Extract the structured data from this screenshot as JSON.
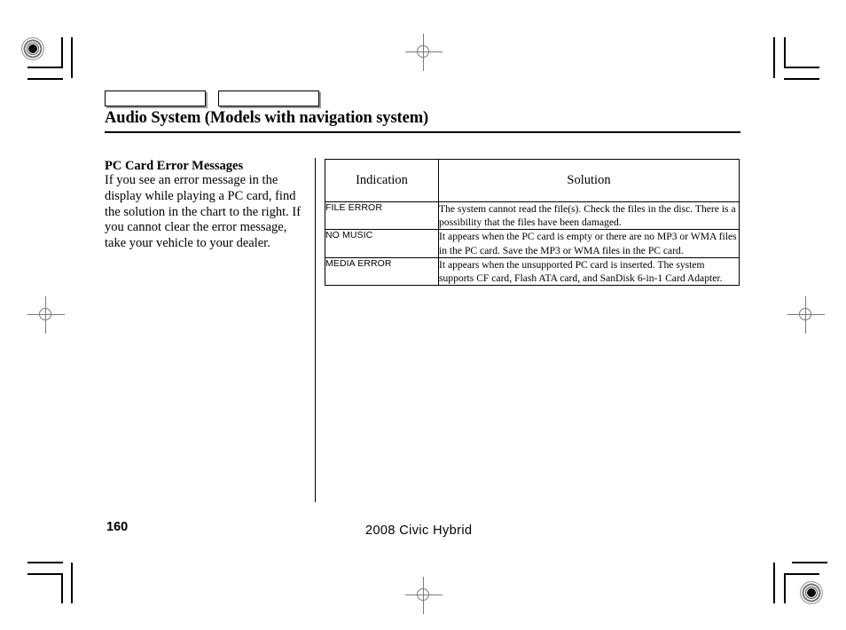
{
  "document": {
    "title": "Audio System (Models with navigation system)",
    "page_number": "160",
    "footer_model": "2008  Civic  Hybrid"
  },
  "header": {
    "tab_box_1_label": "",
    "tab_box_2_label": ""
  },
  "left_column": {
    "heading": "PC Card Error Messages",
    "body": "If you see an error message in the display while playing a PC card, find the solution in the chart to the right. If you cannot clear the error message, take your vehicle to your dealer."
  },
  "table": {
    "columns": [
      "Indication",
      "Solution"
    ],
    "rows": [
      {
        "indication": "FILE ERROR",
        "solution": "The system cannot read the file(s). Check the files in the disc. There is a possibility that the files have been damaged."
      },
      {
        "indication": "NO MUSIC",
        "solution": "It appears when the PC card is empty or there are no MP3 or WMA files in the PC card. Save the MP3 or WMA files in the PC card."
      },
      {
        "indication": "MEDIA ERROR",
        "solution": "It appears when the unsupported PC card is inserted. The system supports CF card, Flash ATA card, and SanDisk 6-in-1 Card Adapter."
      }
    ]
  }
}
